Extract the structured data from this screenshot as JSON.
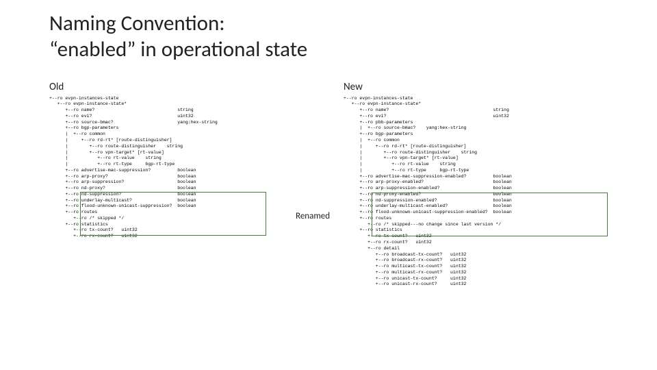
{
  "title_line1": "Naming Convention:",
  "title_line2": "“enabled” in operational state",
  "old_label": "Old",
  "new_label": "New",
  "renamed_label": "Renamed",
  "tree_old": "+--ro evpn-instances-state\n   +--ro evpn-instance-state*\n      +--ro name?                               string\n      +--ro evi?                                uint32\n      +--ro source-bmac?                        yang:hex-string\n      +--ro bgp-parameters\n      |  +--ro common\n      |     +--ro rd-rt* [route-distinguisher]\n      |        +--ro route-distinguisher    string\n      |        +--ro vpn-target* [rt-value]\n      |           +--ro rt-value    string\n      |           +--ro rt-type     bgp-rt-type\n      +--ro advertise-mac-suppression?          boolean\n      +--ro arp-proxy?                          boolean\n      +--ro arp-suppression?                    boolean\n      +--ro nd-proxy?                           boolean\n      +--ro nd-suppression?                     boolean\n      +--ro underlay-multicast?                 boolean\n      +--ro flood-unknown-unicast-suppression?  boolean\n      +--ro routes\n         +--ro /* skipped */\n      +--ro statistics\n         +--ro tx-count?   uint32\n         +--ro rx-count?   uint32",
  "tree_new": "+--ro evpn-instances-state\n   +--ro evpn-instance-state*\n      +--ro name?                                       string\n      +--ro evi?                                        uint32\n      +--ro pbb-parameters\n      |  +--ro source-bmac?    yang:hex-string\n      +--ro bgp-parameters\n      |  +--ro common\n      |     +--ro rd-rt* [route-distinguisher]\n      |        +--ro route-distinguisher    string\n      |        +--ro vpn-target* [rt-value]\n      |           +--ro rt-value    string\n      |           +--ro rt-type     bgp-rt-type\n      +--ro advertise-mac-suppression-enabled?          boolean\n      +--ro arp-proxy-enabled?                          boolean\n      +--ro arp-suppression-enabled?                    boolean\n      +--ro nd-proxy-enabled?                           boolean\n      +--ro nd-suppression-enabled?                     boolean\n      +--ro underlay-multicast-enabled?                 boolean\n      +--ro flood-unknown-unicast-suppression-enabled?  boolean\n      +--ro routes\n         +--ro /* skipped---no change since last version */\n      +--ro statistics\n         +--ro tx-count?   uint32\n         +--ro rx-count?   uint32\n         +--ro detail\n            +--ro broadcast-tx-count?   uint32\n            +--ro broadcast-rx-count?   uint32\n            +--ro multicast-tx-count?   uint32\n            +--ro multicast-rx-count?   uint32\n            +--ro unicast-tx-count?     uint32\n            +--ro unicast-rx-count?     uint32"
}
